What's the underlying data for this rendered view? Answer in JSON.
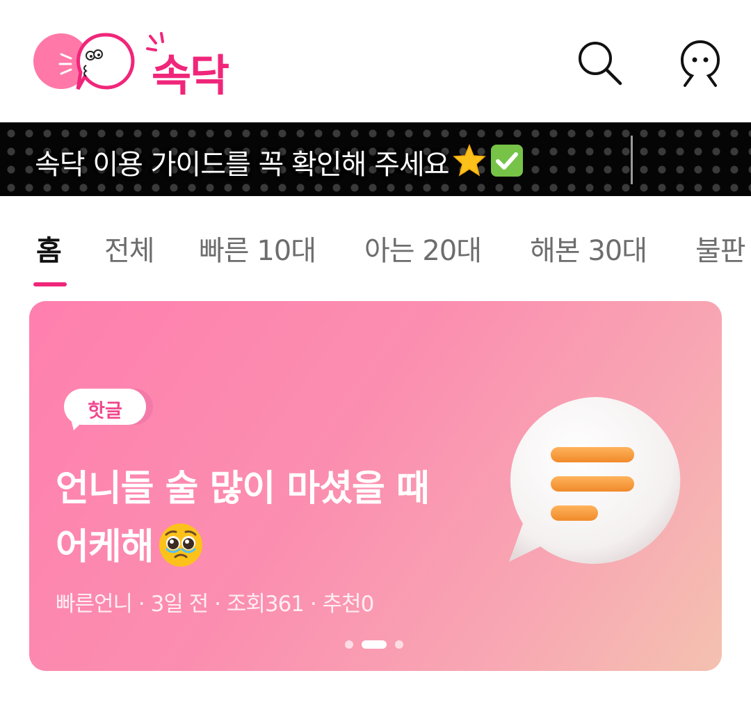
{
  "app": {
    "logo_text": "속닥"
  },
  "notice": {
    "text": "속닥 이용 가이드를 꼭 확인해 주세요"
  },
  "tabs": [
    {
      "label": "홈"
    },
    {
      "label": "전체"
    },
    {
      "label": "빠른 10대"
    },
    {
      "label": "아는 20대"
    },
    {
      "label": "해본 30대"
    },
    {
      "label": "불판"
    }
  ],
  "hero": {
    "badge": "핫글",
    "title_line1": "언니들 술 많이 마셨을 때",
    "title_line2": "어케해",
    "meta": "빠른언니 · 3일 전 · 조회361 · 추천0",
    "slide_count": 3,
    "active_slide": 2
  },
  "icons": {
    "search": "search-icon",
    "profile": "profile-icon",
    "star": "star-emoji",
    "check": "check-mark-emoji",
    "pleading": "pleading-face-emoji",
    "bubble": "chat-bubble-illustration"
  },
  "colors": {
    "brand": "#f0267a",
    "card_start": "#ff7fae",
    "card_end": "#f4c1b0",
    "notice_bg": "#050505"
  }
}
